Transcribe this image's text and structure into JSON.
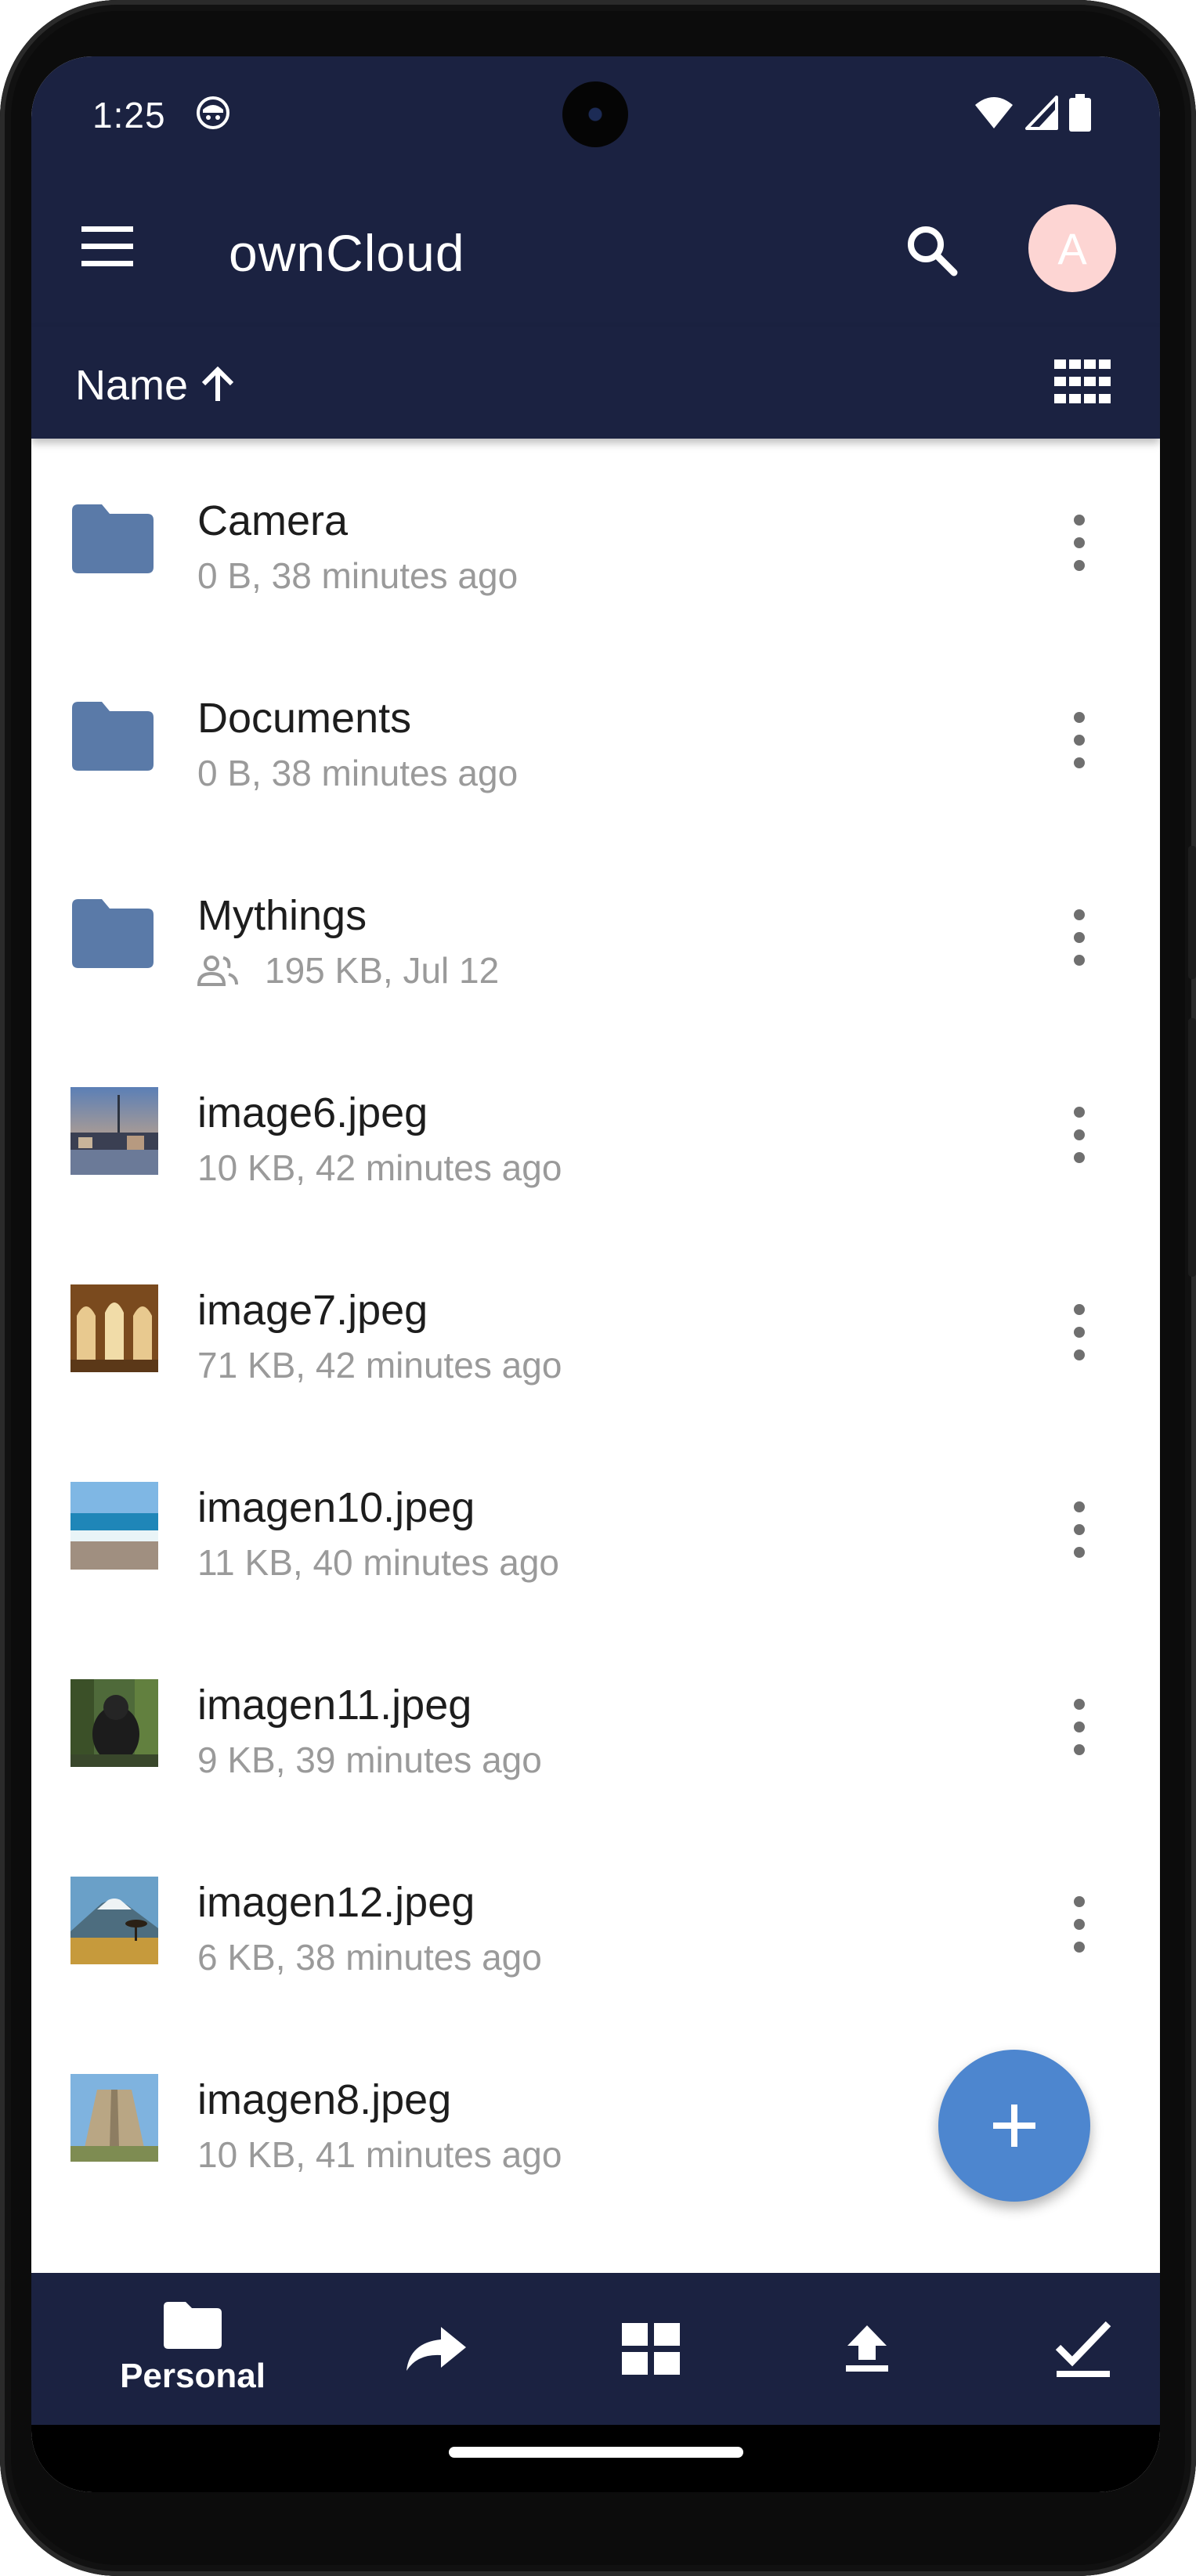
{
  "status_bar": {
    "time": "1:25"
  },
  "toolbar": {
    "title": "ownCloud",
    "avatar_letter": "A"
  },
  "sort_bar": {
    "label": "Name",
    "direction_icon": "arrow-up-icon"
  },
  "files": [
    {
      "name": "Camera",
      "meta": "0 B, 38 minutes ago",
      "type": "folder",
      "shared": false
    },
    {
      "name": "Documents",
      "meta": "0 B, 38 minutes ago",
      "type": "folder",
      "shared": false
    },
    {
      "name": "Mythings",
      "meta": "195 KB, Jul 12",
      "type": "folder",
      "shared": true
    },
    {
      "name": "image6.jpeg",
      "meta": "10 KB, 42 minutes ago",
      "type": "image",
      "shared": false
    },
    {
      "name": "image7.jpeg",
      "meta": "71 KB, 42 minutes ago",
      "type": "image",
      "shared": false
    },
    {
      "name": "imagen10.jpeg",
      "meta": "11 KB, 40 minutes ago",
      "type": "image",
      "shared": false
    },
    {
      "name": "imagen11.jpeg",
      "meta": "9 KB, 39 minutes ago",
      "type": "image",
      "shared": false
    },
    {
      "name": "imagen12.jpeg",
      "meta": "6 KB, 38 minutes ago",
      "type": "image",
      "shared": false
    },
    {
      "name": "imagen8.jpeg",
      "meta": "10 KB, 41 minutes ago",
      "type": "image",
      "shared": false
    }
  ],
  "bottom_nav": {
    "personal_label": "Personal"
  },
  "colors": {
    "bar_background": "#1b2241",
    "folder": "#5a7aa8",
    "fab": "#4d86cf",
    "avatar": "#fdd5d3",
    "meta_text": "#9a9a9a"
  }
}
